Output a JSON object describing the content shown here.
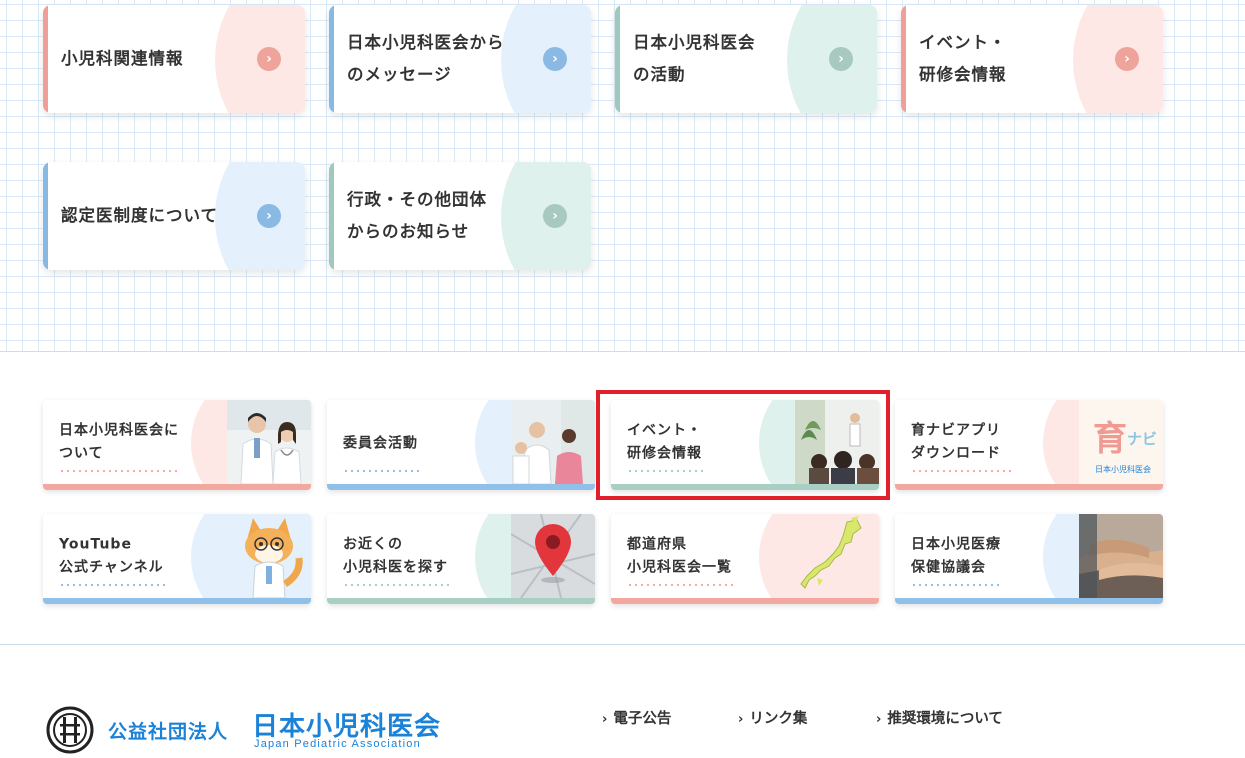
{
  "nav_cards": [
    {
      "lines": [
        "小児科関連情報"
      ],
      "theme": "pink",
      "icon": "chevron-right-icon"
    },
    {
      "lines": [
        "日本小児科医会から",
        "のメッセージ"
      ],
      "theme": "blue",
      "icon": "chevron-right-icon"
    },
    {
      "lines": [
        "日本小児科医会",
        "の活動"
      ],
      "theme": "teal",
      "icon": "chevron-right-icon"
    },
    {
      "lines": [
        "イベント・",
        "研修会情報"
      ],
      "theme": "pink",
      "icon": "chevron-right-icon"
    },
    {
      "lines": [
        "認定医制度について"
      ],
      "theme": "blue",
      "icon": "chevron-right-icon"
    },
    {
      "lines": [
        "行政・その他団体",
        "からのお知らせ"
      ],
      "theme": "teal",
      "icon": "chevron-right-icon"
    }
  ],
  "banners": [
    {
      "lines": [
        "日本小児科医会に",
        "ついて"
      ],
      "theme": "pink",
      "image": "doctors-photo"
    },
    {
      "lines": [
        "委員会活動"
      ],
      "theme": "blue",
      "image": "meeting-photo"
    },
    {
      "lines": [
        "イベント・",
        "研修会情報"
      ],
      "theme": "teal",
      "image": "lecture-photo",
      "highlighted": true
    },
    {
      "lines": [
        "育ナビアプリ",
        "ダウンロード"
      ],
      "theme": "pink",
      "image": "ikunavi-logo",
      "image_text": {
        "main": "育",
        "sub": "ナビ",
        "org": "日本小児科医会"
      }
    },
    {
      "lines": [
        "YouTube",
        "公式チャンネル"
      ],
      "theme": "blue",
      "image": "fox-doctor-mascot"
    },
    {
      "lines": [
        "お近くの",
        "小児科医を探す"
      ],
      "theme": "teal",
      "image": "map-pin-photo"
    },
    {
      "lines": [
        "都道府県",
        "小児科医会一覧"
      ],
      "theme": "pink",
      "image": "japan-map"
    },
    {
      "lines": [
        "日本小児医療",
        "保健協議会"
      ],
      "theme": "blue",
      "image": "hands-photo"
    }
  ],
  "footer": {
    "org_type": "公益社団法人",
    "org_name": "日本小児科医会",
    "org_name_en": "Japan Pediatric Association",
    "links": [
      "電子公告",
      "リンク集",
      "推奨環境について"
    ]
  },
  "colors": {
    "brand_blue": "#1a82d8",
    "pink": "#ef9f98",
    "blue": "#88b9e3",
    "teal": "#9fc9bc",
    "highlight": "#e0202a"
  }
}
